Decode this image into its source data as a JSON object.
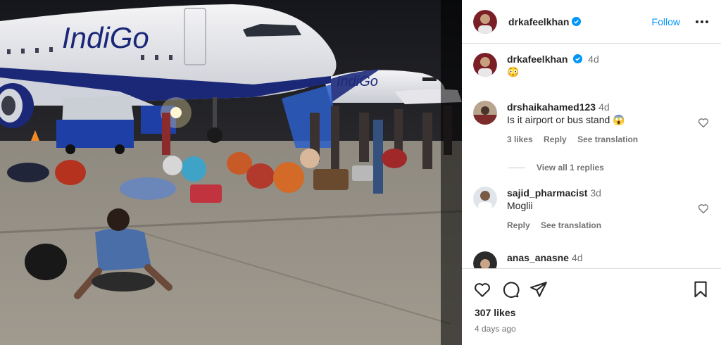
{
  "post": {
    "author": "drkafeelkhan",
    "follow_label": "Follow",
    "caption": {
      "author": "drkafeelkhan",
      "time": "4d",
      "text": "😳"
    },
    "likes": "307 likes",
    "date": "4 days ago",
    "photo_text": {
      "plane1_logo": "IndiGo",
      "plane2_logo": "IndiGo"
    }
  },
  "comments": [
    {
      "user": "drshaikahamed123",
      "time": "4d",
      "text": "Is it airport or bus stand 😱",
      "likes": "3 likes",
      "reply": "Reply",
      "translate": "See translation"
    },
    {
      "user": "sajid_pharmacist",
      "time": "3d",
      "text": "Moglii",
      "reply": "Reply",
      "translate": "See translation"
    },
    {
      "user": "anas_anasne",
      "time": "4d"
    }
  ],
  "view_replies": "View all 1 replies",
  "icons": [
    "verified-badge-icon",
    "more-options-icon",
    "heart-icon",
    "comment-icon",
    "share-icon",
    "bookmark-icon"
  ],
  "colors": {
    "accent": "#0095f6",
    "verified": "#0095f6",
    "muted": "#737373",
    "divider": "#dbdbdb"
  }
}
